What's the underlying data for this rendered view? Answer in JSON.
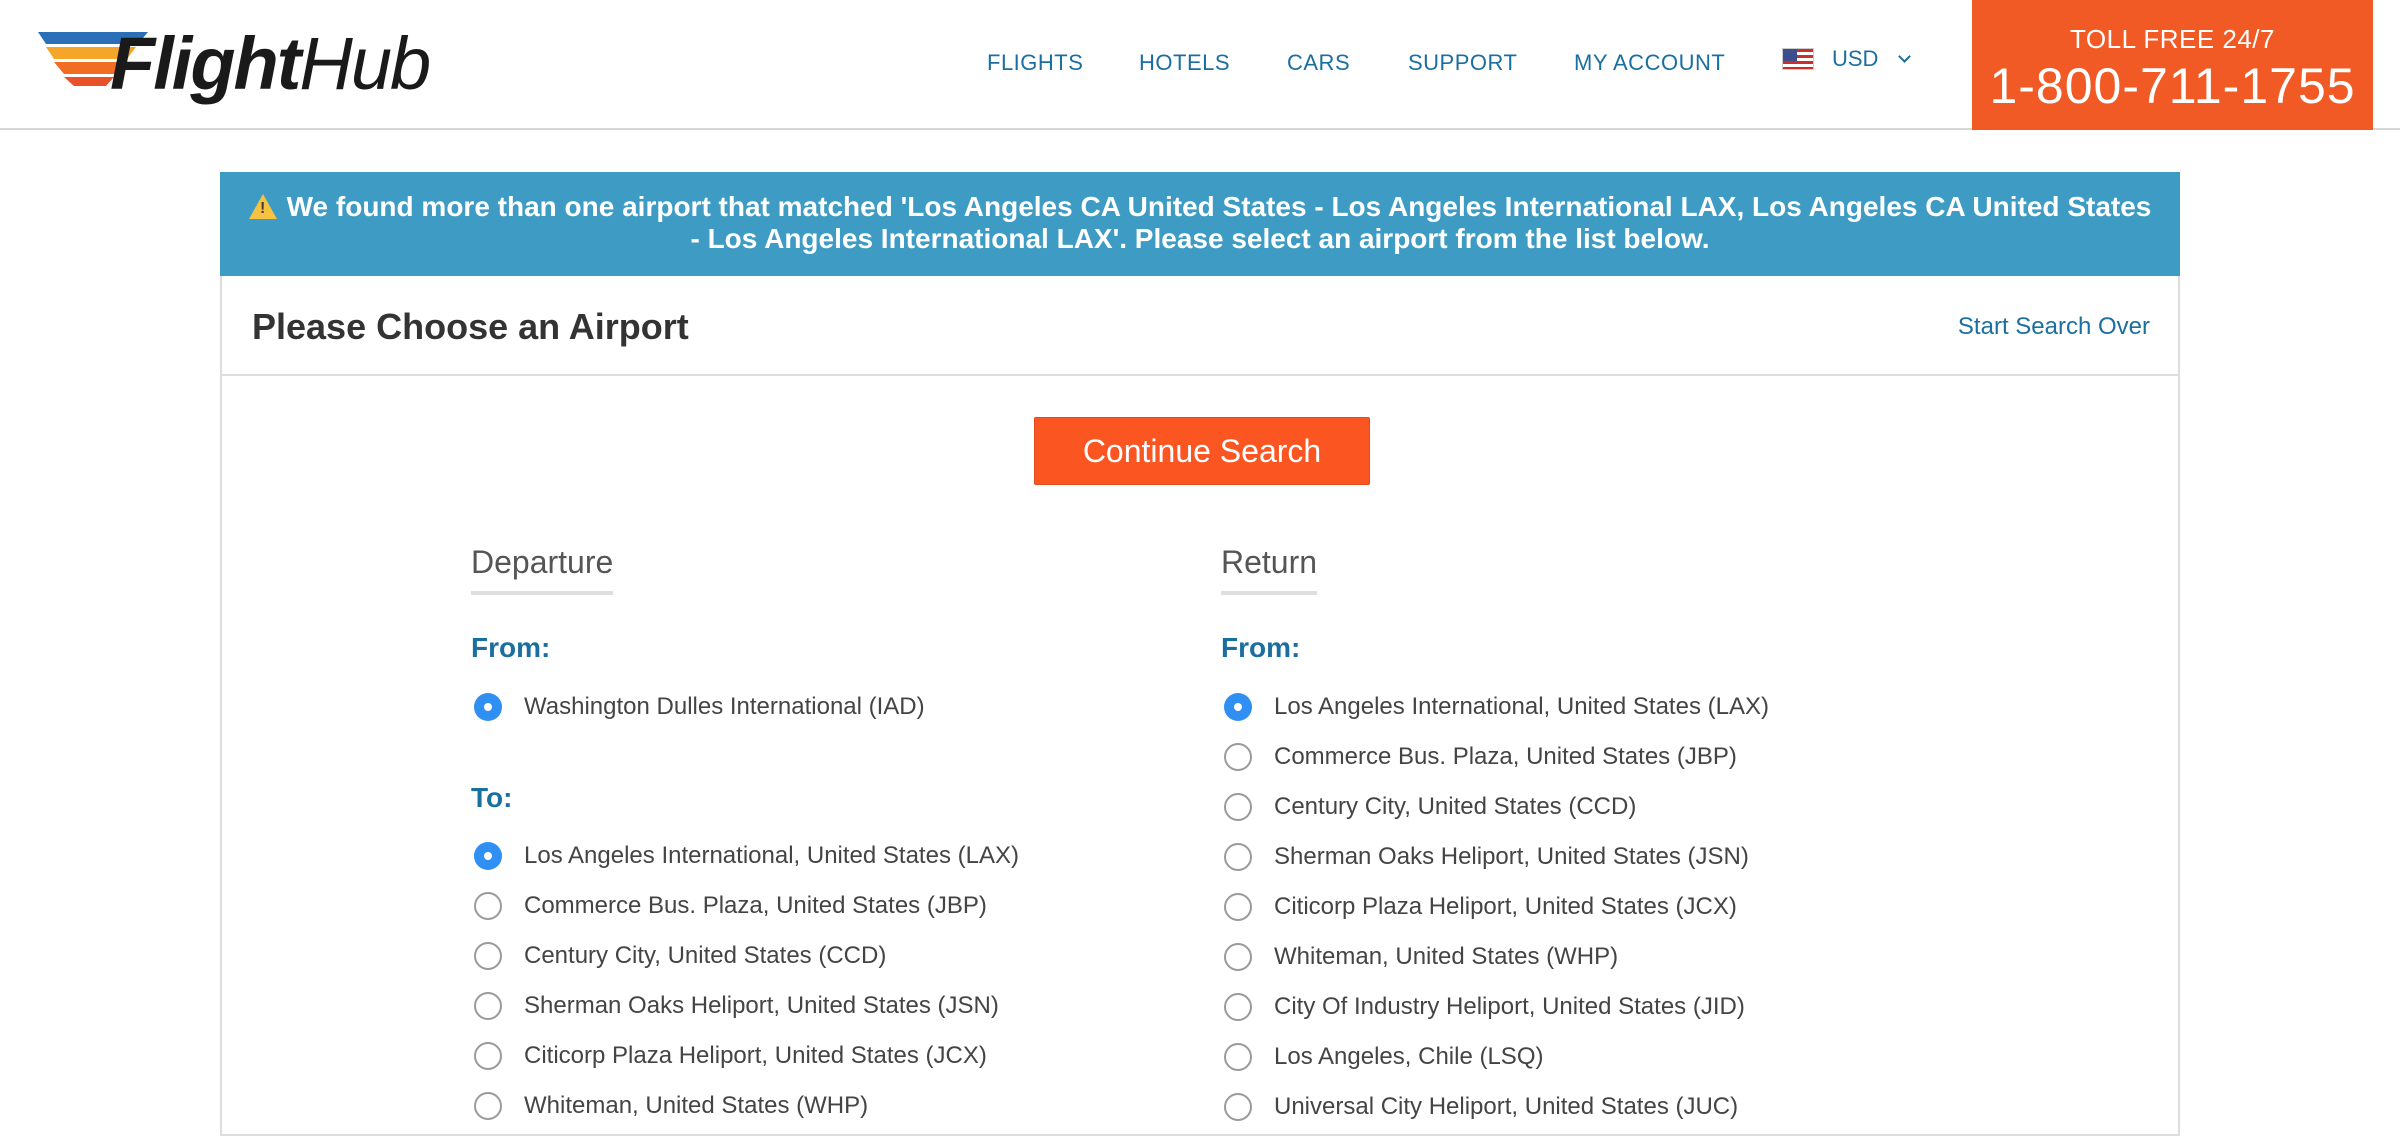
{
  "brand": {
    "name_bold": "Flight",
    "name_light": "Hub"
  },
  "nav": {
    "items": [
      "FLIGHTS",
      "HOTELS",
      "CARS",
      "SUPPORT",
      "MY ACCOUNT"
    ],
    "currency": "USD",
    "toll_free_label": "TOLL FREE 24/7",
    "phone": "1-800-711-1755"
  },
  "alert": {
    "line1": "We found more than one airport that matched 'Los Angeles CA United States - Los Angeles International LAX, Los Angeles CA United States",
    "line2": "- Los Angeles International LAX'.   Please select an airport from the list below."
  },
  "card": {
    "title": "Please Choose an Airport",
    "start_over": "Start Search Over",
    "continue_label": "Continue Search"
  },
  "departure": {
    "title": "Departure",
    "from_label": "From:",
    "from_options": [
      {
        "label": "Washington Dulles International (IAD)",
        "selected": true
      }
    ],
    "to_label": "To:",
    "to_options": [
      {
        "label": "Los Angeles International, United States (LAX)",
        "selected": true
      },
      {
        "label": "Commerce Bus. Plaza, United States (JBP)",
        "selected": false
      },
      {
        "label": "Century City, United States (CCD)",
        "selected": false
      },
      {
        "label": "Sherman Oaks Heliport, United States (JSN)",
        "selected": false
      },
      {
        "label": "Citicorp Plaza Heliport, United States (JCX)",
        "selected": false
      },
      {
        "label": "Whiteman, United States (WHP)",
        "selected": false
      }
    ]
  },
  "return": {
    "title": "Return",
    "from_label": "From:",
    "from_options": [
      {
        "label": "Los Angeles International, United States (LAX)",
        "selected": true
      },
      {
        "label": "Commerce Bus. Plaza, United States (JBP)",
        "selected": false
      },
      {
        "label": "Century City, United States (CCD)",
        "selected": false
      },
      {
        "label": "Sherman Oaks Heliport, United States (JSN)",
        "selected": false
      },
      {
        "label": "Citicorp Plaza Heliport, United States (JCX)",
        "selected": false
      },
      {
        "label": "Whiteman, United States (WHP)",
        "selected": false
      },
      {
        "label": "City Of Industry Heliport, United States (JID)",
        "selected": false
      },
      {
        "label": "Los Angeles, Chile (LSQ)",
        "selected": false
      },
      {
        "label": "Universal City Heliport, United States (JUC)",
        "selected": false
      }
    ]
  },
  "colors": {
    "nav_link": "#1b6fa0",
    "accent_orange": "#f15a24",
    "alert_blue": "#3e9cc4",
    "radio_selected": "#2f8ff2"
  }
}
